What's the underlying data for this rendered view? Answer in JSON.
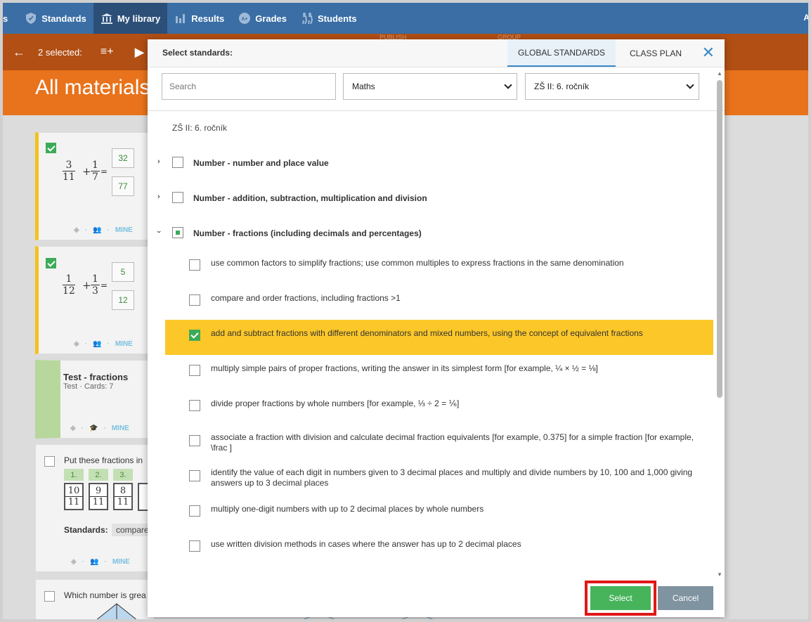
{
  "nav": {
    "edge_label": "s",
    "items": [
      {
        "label": "Standards",
        "icon": "shield-icon"
      },
      {
        "label": "My library",
        "icon": "library-icon"
      },
      {
        "label": "Results",
        "icon": "bar-chart-icon"
      },
      {
        "label": "Grades",
        "icon": "grades-icon"
      },
      {
        "label": "Students",
        "icon": "students-icon"
      }
    ],
    "right_label": "A"
  },
  "selection_bar": {
    "count_label": "2 selected:",
    "faint_left": "PUBLISH",
    "faint_right": "GROUP"
  },
  "header": {
    "title": "All materials"
  },
  "cards": [
    {
      "fraction_a": {
        "num": "3",
        "den": "11"
      },
      "fraction_b": {
        "num": "1",
        "den": "7"
      },
      "answer_num": "32",
      "answer_den": "77",
      "mine": "MINE"
    },
    {
      "fraction_a": {
        "num": "1",
        "den": "12"
      },
      "fraction_b": {
        "num": "1",
        "den": "3"
      },
      "answer_num": "5",
      "answer_den": "12",
      "mine": "MINE"
    },
    {
      "title": "Test - fractions",
      "subtitle": "Test · Cards: 7",
      "mine": "MINE"
    },
    {
      "title": "Put these fractions in",
      "labels": [
        "1.",
        "2.",
        "3."
      ],
      "fractions": [
        {
          "num": "10",
          "den": "11"
        },
        {
          "num": "9",
          "den": "11"
        },
        {
          "num": "8",
          "den": "11"
        }
      ],
      "standards_label": "Standards:",
      "standards_value": "compare",
      "mine": "MINE"
    },
    {
      "title": "Which number is grea"
    }
  ],
  "modal": {
    "title": "Select standards:",
    "tabs": [
      "GLOBAL STANDARDS",
      "CLASS PLAN"
    ],
    "search_placeholder": "Search",
    "subject": "Maths",
    "grade": "ZŠ II: 6. ročník",
    "crumb": "ZŠ II: 6. ročník",
    "groups": [
      {
        "label": "Number - number and place value"
      },
      {
        "label": "Number - addition, subtraction, multiplication and division"
      },
      {
        "label": "Number - fractions (including decimals and percentages)"
      }
    ],
    "items": [
      {
        "text": "use common factors to simplify fractions; use common multiples to express fractions in the same denomination",
        "checked": false
      },
      {
        "text": "compare and order fractions, including fractions >1",
        "checked": false
      },
      {
        "text": "add and subtract fractions with different denominators and mixed numbers, using the concept of equivalent fractions",
        "checked": true
      },
      {
        "text": "multiply simple pairs of proper fractions, writing the answer in its simplest form [for example, ¼ × ½ = ⅛]",
        "checked": false
      },
      {
        "text": "divide proper fractions by whole numbers [for example, ⅓ ÷ 2 = ⅙]",
        "checked": false
      },
      {
        "text": "associate a fraction with division and calculate decimal fraction equivalents [for example, 0.375] for a simple fraction [for example, \\frac ]",
        "checked": false
      },
      {
        "text": "identify the value of each digit in numbers given to 3 decimal places and multiply and divide numbers by 10, 100 and 1,000 giving answers up to 3 decimal places",
        "checked": false
      },
      {
        "text": "multiply one-digit numbers with up to 2 decimal places by whole numbers",
        "checked": false
      },
      {
        "text": "use written division methods in cases where the answer has up to 2 decimal places",
        "checked": false
      }
    ],
    "select_label": "Select",
    "cancel_label": "Cancel"
  },
  "colors": {
    "nav": "#3a6ea5",
    "selection_bar": "#b14f14",
    "header": "#e8731c",
    "highlight": "#fcc728",
    "select_button": "#47b45b",
    "cancel_button": "#7f93a0",
    "focus_outline": "#e01818"
  }
}
